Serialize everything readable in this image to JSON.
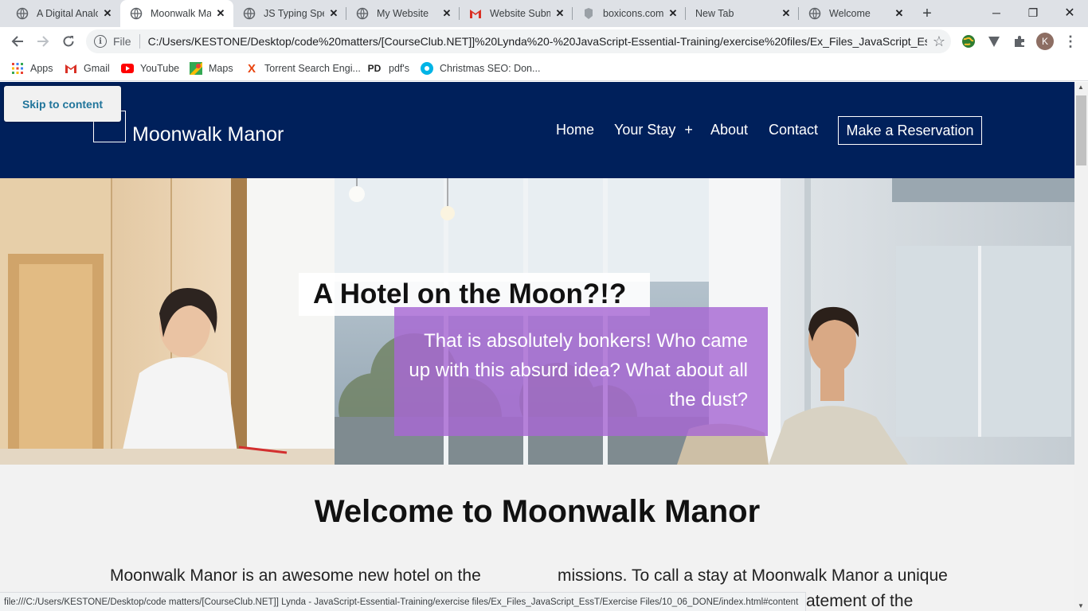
{
  "browser": {
    "tabs": [
      {
        "title": "A Digital Analo",
        "icon": "globe-icon"
      },
      {
        "title": "Moonwalk Ma",
        "icon": "globe-icon",
        "active": true
      },
      {
        "title": "JS Typing Spee",
        "icon": "globe-icon"
      },
      {
        "title": "My Website",
        "icon": "globe-icon"
      },
      {
        "title": "Website Subm",
        "icon": "gmail-icon"
      },
      {
        "title": "boxicons.com",
        "icon": "boxicons-icon"
      },
      {
        "title": "New Tab",
        "icon": ""
      },
      {
        "title": "Welcome",
        "icon": "globe-icon"
      }
    ],
    "address": {
      "scheme": "File",
      "url": "C:/Users/KESTONE/Desktop/code%20matters/[CourseClub.NET]]%20Lynda%20-%20JavaScript-Essential-Training/exercise%20files/Ex_Files_JavaScript_EssT/E..."
    },
    "bookmarks": [
      {
        "label": "Apps",
        "icon": "apps-grid-icon"
      },
      {
        "label": "Gmail",
        "icon": "gmail-icon"
      },
      {
        "label": "YouTube",
        "icon": "youtube-icon"
      },
      {
        "label": "Maps",
        "icon": "maps-icon"
      },
      {
        "label": "Torrent Search Engi...",
        "icon": "torrent-icon"
      },
      {
        "label": "pdf's",
        "icon": "pdf-icon"
      },
      {
        "label": "Christmas SEO: Don...",
        "icon": "seo-icon"
      }
    ],
    "profile_initial": "K",
    "status_url": "file:///C:/Users/KESTONE/Desktop/code matters/[CourseClub.NET]] Lynda - JavaScript-Essential-Training/exercise files/Ex_Files_JavaScript_EssT/Exercise Files/10_06_DONE/index.html#content"
  },
  "page": {
    "skip_link": "Skip to content",
    "site_name": "Moonwalk Manor",
    "nav": {
      "home": "Home",
      "your_stay": "Your Stay",
      "your_stay_toggle": "+",
      "about": "About",
      "contact": "Contact",
      "reserve": "Make a Reservation"
    },
    "hero": {
      "title": "A Hotel on the Moon?!?",
      "subtitle": "That is absolutely bonkers! Who came up with this absurd idea? What about all the dust?"
    },
    "welcome": {
      "heading": "Welcome to Moonwalk Manor",
      "col1_line1": "Moonwalk Manor is an awesome new hotel on the",
      "col2_line1": "missions. To call a stay at Moonwalk Manor a unique",
      "col2_line2": "atement of the"
    }
  },
  "colors": {
    "header_bg": "#00205b",
    "accent_purple": "#a768d3",
    "skip_link_text": "#21759b"
  }
}
